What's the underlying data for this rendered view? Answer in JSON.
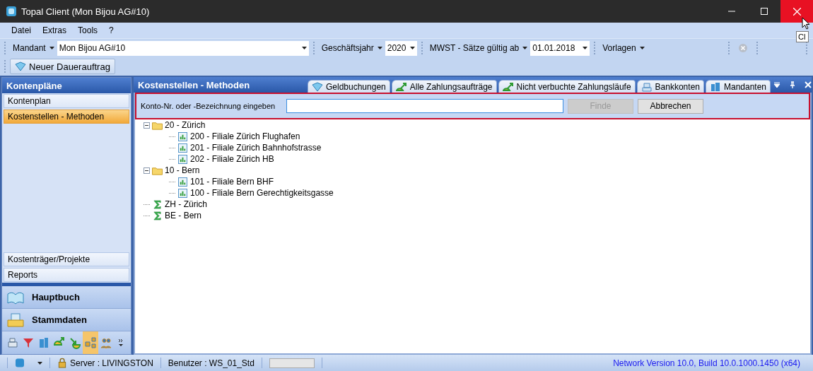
{
  "window": {
    "title": "Topal Client (Mon Bijou AG#10)",
    "tooltip": "Cl"
  },
  "menu": [
    "Datei",
    "Extras",
    "Tools",
    "?"
  ],
  "toolbar": {
    "mandant_label": "Mandant",
    "mandant_value": "Mon Bijou AG#10",
    "year_label": "Geschäftsjahr",
    "year_value": "2020",
    "vat_label": "MWST - Sätze gültig ab",
    "vat_value": "01.01.2018",
    "templates_label": "Vorlagen"
  },
  "action_button": "Neuer Dauerauftrag",
  "sidebar": {
    "title": "Kontenpläne",
    "items": [
      {
        "label": "Kontenplan",
        "selected": false
      },
      {
        "label": "Kostenstellen - Methoden",
        "selected": true
      }
    ],
    "bottom_items": [
      {
        "label": "Kostenträger/Projekte",
        "selected": false
      },
      {
        "label": "Reports",
        "selected": false
      }
    ],
    "sections": [
      "Hauptbuch",
      "Stammdaten"
    ],
    "shortcuts": [
      {
        "selected": false
      },
      {
        "selected": false
      },
      {
        "selected": false
      },
      {
        "selected": false
      },
      {
        "selected": false
      },
      {
        "selected": true
      },
      {
        "selected": false
      }
    ]
  },
  "panel": {
    "title": "Kostenstellen - Methoden",
    "tabs": [
      {
        "label": "Geldbuchungen",
        "selected": false
      },
      {
        "label": "Alle Zahlungsaufträge",
        "selected": false
      },
      {
        "label": "Nicht verbuchte Zahlungsläufe",
        "selected": false
      },
      {
        "label": "Bankkonten",
        "selected": false
      },
      {
        "label": "Mandanten",
        "selected": false
      }
    ],
    "search": {
      "label": "Konto-Nr. oder -Bezeichnung eingeben",
      "find_button": "Finde",
      "find_disabled": true,
      "cancel_button": "Abbrechen"
    },
    "tree": [
      {
        "label": "20 - Zürich",
        "kind": "folder",
        "expanded": true,
        "children": [
          {
            "label": "200 - Filiale Zürich Flughafen",
            "kind": "account"
          },
          {
            "label": "201 - Filiale Zürich Bahnhofstrasse",
            "kind": "account"
          },
          {
            "label": "202 - Filiale Zürich HB",
            "kind": "account"
          }
        ]
      },
      {
        "label": "10 - Bern",
        "kind": "folder",
        "expanded": true,
        "children": [
          {
            "label": "101 - Filiale Bern BHF",
            "kind": "account"
          },
          {
            "label": "100 - Filiale Bern Gerechtigkeitsgasse",
            "kind": "account"
          }
        ]
      },
      {
        "label": "ZH - Zürich",
        "kind": "sum"
      },
      {
        "label": "BE - Bern",
        "kind": "sum"
      }
    ]
  },
  "status_bar": {
    "server": "Server : LIVINGSTON",
    "user": "Benutzer : WS_01_Std",
    "progress": {
      "level": 0
    },
    "version": "Network Version 10.0, Build 10.0.1000.1450 (x64)"
  }
}
